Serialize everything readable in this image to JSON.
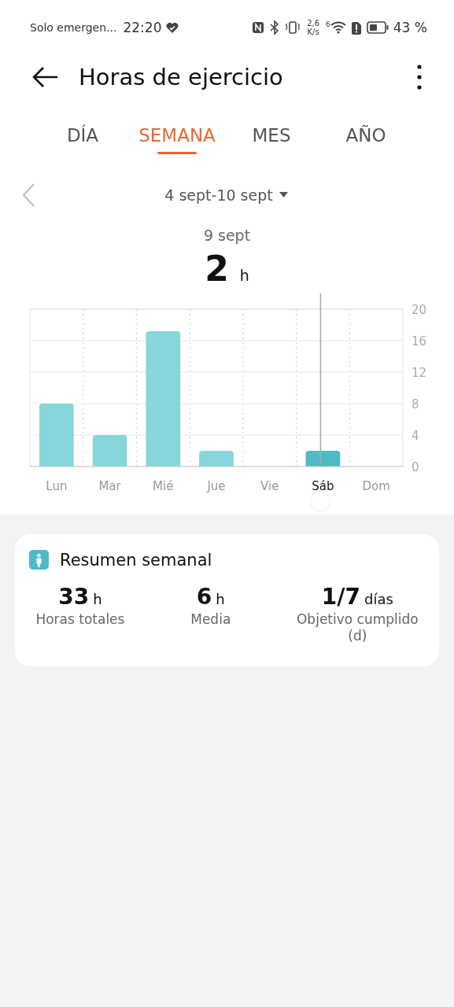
{
  "status_bar": {
    "carrier": "Solo emergen...",
    "time": "22:20",
    "speed_value": "2,6",
    "speed_unit": "K/s",
    "wifi_label": "6",
    "battery": "43 %"
  },
  "header": {
    "title": "Horas de ejercicio"
  },
  "tabs": [
    {
      "label": "DÍA",
      "selected": false
    },
    {
      "label": "SEMANA",
      "selected": true
    },
    {
      "label": "MES",
      "selected": false
    },
    {
      "label": "AÑO",
      "selected": false
    }
  ],
  "period": {
    "range": "4 sept-10 sept",
    "day": "9 sept",
    "value": "2",
    "unit": "h"
  },
  "chart_data": {
    "type": "bar",
    "categories": [
      "Lun",
      "Mar",
      "Mié",
      "Jue",
      "Vie",
      "Sáb",
      "Dom"
    ],
    "series": [
      {
        "color": "#86d6dc",
        "values": [
          8,
          4,
          17.2,
          2,
          0,
          null,
          0
        ]
      },
      {
        "color": "#4fb9c5",
        "values": [
          null,
          null,
          null,
          null,
          null,
          2,
          null
        ]
      }
    ],
    "stacked": true,
    "ylim": [
      0,
      20
    ],
    "yticks": [
      0,
      4,
      8,
      12,
      16,
      20
    ],
    "grid": true,
    "ref_lines": [
      {
        "axis": "x",
        "value": "Sáb",
        "color": "#aaaaaa"
      }
    ]
  },
  "summary": {
    "title": "Resumen semanal",
    "stats": [
      {
        "value": "33",
        "unit": "h",
        "label": "Horas totales"
      },
      {
        "value": "6",
        "unit": "h",
        "label": "Media"
      },
      {
        "value": "1/7",
        "unit": "días",
        "label": "Objetivo cumplido (d)"
      }
    ]
  }
}
